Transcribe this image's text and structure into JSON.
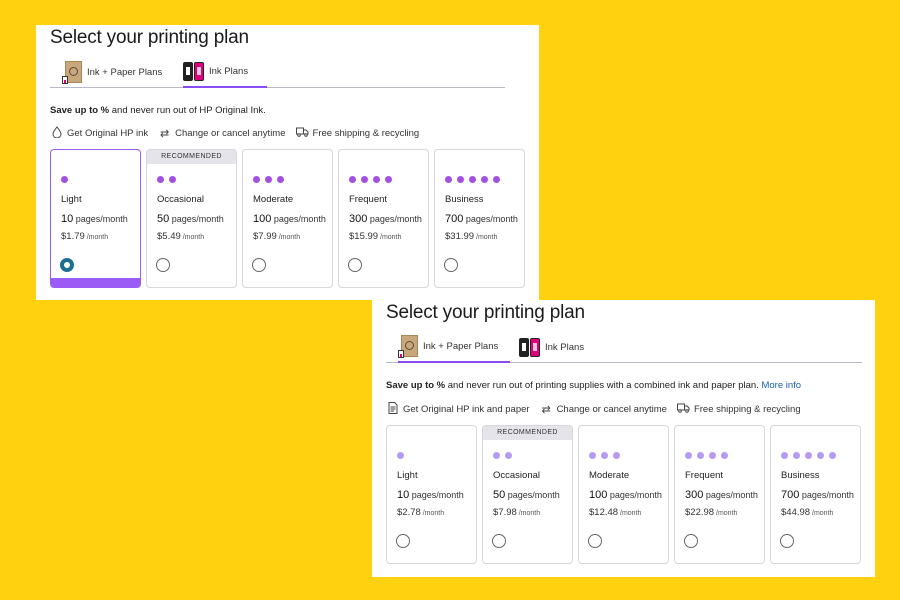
{
  "colors": {
    "background": "#FFD10F",
    "accent": "#8a4cf2",
    "dot_ink": "#a24fe3",
    "dot_bundle": "#b49af0",
    "radio_checked": "#1d6f94",
    "link": "#1a5dad"
  },
  "panel1": {
    "title": "Select your printing plan",
    "tabs": [
      {
        "label": "Ink + Paper Plans",
        "icon": "ink-paper-box-icon",
        "active": false
      },
      {
        "label": "Ink Plans",
        "icon": "ink-cartridges-icon",
        "active": true
      }
    ],
    "promo": {
      "bold": "Save up to %",
      "rest": " and never run out of HP Original Ink."
    },
    "features": [
      {
        "icon": "ink-drop-icon",
        "label": "Get Original HP ink"
      },
      {
        "icon": "refresh-icon",
        "label": "Change or cancel anytime"
      },
      {
        "icon": "truck-icon",
        "label": "Free shipping & recycling"
      }
    ],
    "recommended_label": "RECOMMENDED",
    "plans": [
      {
        "level": "Light",
        "pages": "10",
        "pages_unit": " pages/month",
        "price": "$1.79",
        "per": " /month"
      },
      {
        "level": "Occasional",
        "pages": "50",
        "pages_unit": " pages/month",
        "price": "$5.49",
        "per": " /month"
      },
      {
        "level": "Moderate",
        "pages": "100",
        "pages_unit": " pages/month",
        "price": "$7.99",
        "per": " /month"
      },
      {
        "level": "Frequent",
        "pages": "300",
        "pages_unit": " pages/month",
        "price": "$15.99",
        "per": " /month"
      },
      {
        "level": "Business",
        "pages": "700",
        "pages_unit": " pages/month",
        "price": "$31.99",
        "per": " /month"
      }
    ]
  },
  "panel2": {
    "title": "Select your printing plan",
    "tabs": [
      {
        "label": "Ink + Paper Plans",
        "icon": "ink-paper-box-icon",
        "active": true
      },
      {
        "label": "Ink Plans",
        "icon": "ink-cartridges-icon",
        "active": false
      }
    ],
    "promo": {
      "bold": "Save up to %",
      "rest": " and never run out of printing supplies with a combined ink and paper plan. ",
      "link": "More info"
    },
    "features": [
      {
        "icon": "document-icon",
        "label": "Get Original HP ink and paper"
      },
      {
        "icon": "refresh-icon",
        "label": "Change or cancel anytime"
      },
      {
        "icon": "truck-icon",
        "label": "Free shipping & recycling"
      }
    ],
    "recommended_label": "RECOMMENDED",
    "plans": [
      {
        "level": "Light",
        "pages": "10",
        "pages_unit": " pages/month",
        "price": "$2.78",
        "per": " /month"
      },
      {
        "level": "Occasional",
        "pages": "50",
        "pages_unit": " pages/month",
        "price": "$7.98",
        "per": " /month"
      },
      {
        "level": "Moderate",
        "pages": "100",
        "pages_unit": " pages/month",
        "price": "$12.48",
        "per": " /month"
      },
      {
        "level": "Frequent",
        "pages": "300",
        "pages_unit": " pages/month",
        "price": "$22.98",
        "per": " /month"
      },
      {
        "level": "Business",
        "pages": "700",
        "pages_unit": " pages/month",
        "price": "$44.98",
        "per": " /month"
      }
    ]
  }
}
